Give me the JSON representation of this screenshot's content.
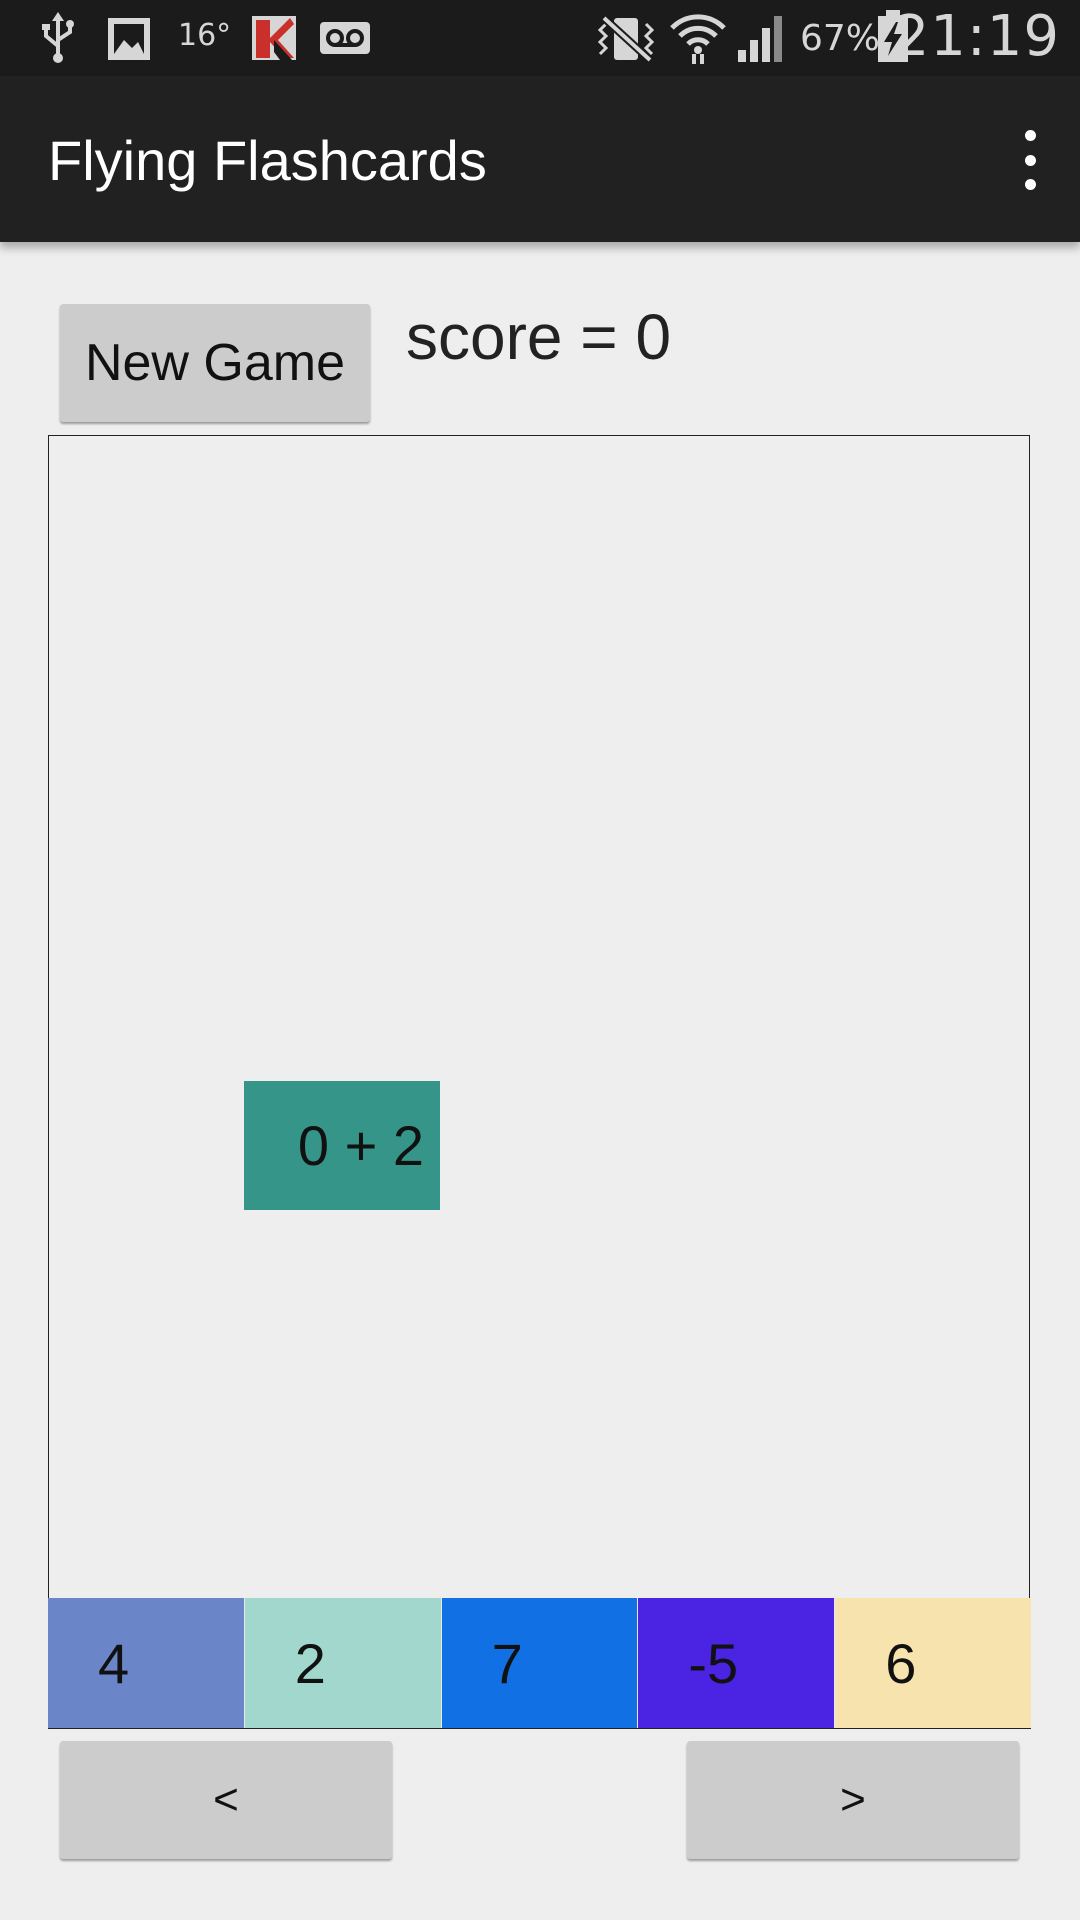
{
  "status_bar": {
    "temperature": "16°",
    "battery": "67%",
    "time": "21:19",
    "icons": [
      "usb-icon",
      "image-icon",
      "kaspersky-icon",
      "voicemail-icon",
      "vibrate-icon",
      "wifi-icon",
      "signal-icon",
      "battery-charging-icon"
    ]
  },
  "app_bar": {
    "title": "Flying Flashcards",
    "menu_icon": "overflow-menu-icon"
  },
  "controls": {
    "new_game_label": "New Game",
    "score_text": "score = 0"
  },
  "flashcard": {
    "question": "0 + 2",
    "color": "#359589"
  },
  "answers": [
    {
      "label": "4",
      "color": "#6a86c8"
    },
    {
      "label": "2",
      "color": "#a1d7cd"
    },
    {
      "label": "7",
      "color": "#1070e4"
    },
    {
      "label": "-5",
      "color": "#4b23e2"
    },
    {
      "label": "6",
      "color": "#f7e3ae"
    }
  ],
  "nav": {
    "prev_label": "<",
    "next_label": ">"
  }
}
